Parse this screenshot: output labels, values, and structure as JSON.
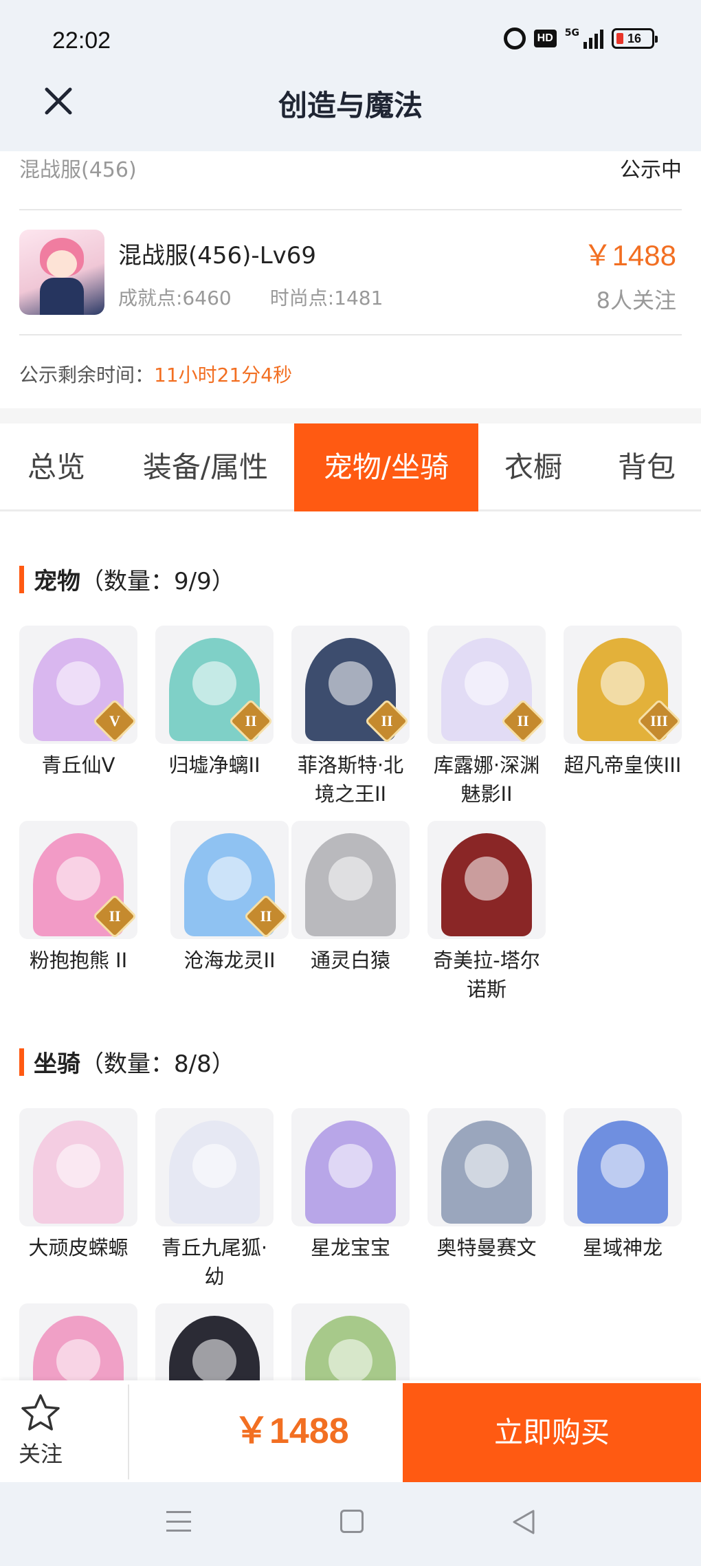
{
  "status_bar": {
    "time": "22:02",
    "hd": "HD",
    "network": "5G",
    "battery": "16"
  },
  "header": {
    "title": "创造与魔法"
  },
  "listing": {
    "server": "混战服(456)",
    "status": "公示中",
    "name": "混战服(456)-Lv69",
    "achievement": "成就点:6460",
    "fashion": "时尚点:1481",
    "price": "￥1488",
    "followers": "8人关注",
    "countdown_label": "公示剩余时间：",
    "countdown_value": "11小时21分4秒"
  },
  "tabs": [
    {
      "label": "总览",
      "active": false
    },
    {
      "label": "装备/属性",
      "active": false
    },
    {
      "label": "宠物/坐骑",
      "active": true
    },
    {
      "label": "衣橱",
      "active": false
    },
    {
      "label": "背包",
      "active": false
    }
  ],
  "pets": {
    "title": "宠物",
    "count": "（数量：9/9）",
    "items": [
      {
        "name": "青丘仙V",
        "badge": "V",
        "color": "#d9b7ef",
        "icon": "fox-fairy-icon"
      },
      {
        "name": "归墟净螭II",
        "badge": "II",
        "color": "#7fd0c7",
        "icon": "sea-dragon-icon"
      },
      {
        "name": "菲洛斯特·北境之王II",
        "badge": "II",
        "color": "#3d4d6e",
        "icon": "frost-king-icon"
      },
      {
        "name": "库露娜·深渊魅影II",
        "badge": "II",
        "color": "#e2dcf5",
        "icon": "abyss-phantom-icon"
      },
      {
        "name": "超凡帝皇侠III",
        "badge": "III",
        "color": "#e3b13a",
        "icon": "emperor-hero-icon"
      },
      {
        "name": "粉抱抱熊 II",
        "badge": "II",
        "color": "#f29bc6",
        "icon": "pink-bear-icon"
      },
      {
        "name": "沧海龙灵II",
        "badge": "II",
        "color": "#8fc2f2",
        "icon": "ocean-dragon-spirit-icon"
      },
      {
        "name": "通灵白猿",
        "badge": "",
        "color": "#b9b9bd",
        "icon": "white-ape-icon"
      },
      {
        "name": "奇美拉-塔尔诺斯",
        "badge": "",
        "color": "#8a2626",
        "icon": "chimera-icon"
      }
    ]
  },
  "mounts": {
    "title": "坐骑",
    "count": "（数量：8/8）",
    "items": [
      {
        "name": "大顽皮蝾螈",
        "color": "#f4cde2",
        "icon": "salamander-icon"
      },
      {
        "name": "青丘九尾狐·幼",
        "color": "#e6e8f3",
        "icon": "nine-tail-fox-icon"
      },
      {
        "name": "星龙宝宝",
        "color": "#b8a6e8",
        "icon": "star-dragon-baby-icon"
      },
      {
        "name": "奥特曼赛文",
        "color": "#9aa6bd",
        "icon": "ultraman-seven-icon"
      },
      {
        "name": "星域神龙",
        "color": "#6f8fe0",
        "icon": "star-domain-dragon-icon"
      },
      {
        "name": "",
        "color": "#f0a0c6",
        "icon": "mount-icon"
      },
      {
        "name": "",
        "color": "#2b2b35",
        "icon": "mount-icon"
      },
      {
        "name": "",
        "color": "#a7c98a",
        "icon": "mount-icon"
      }
    ]
  },
  "bottom": {
    "follow_label": "关注",
    "price": "￥1488",
    "buy_label": "立即购买"
  }
}
